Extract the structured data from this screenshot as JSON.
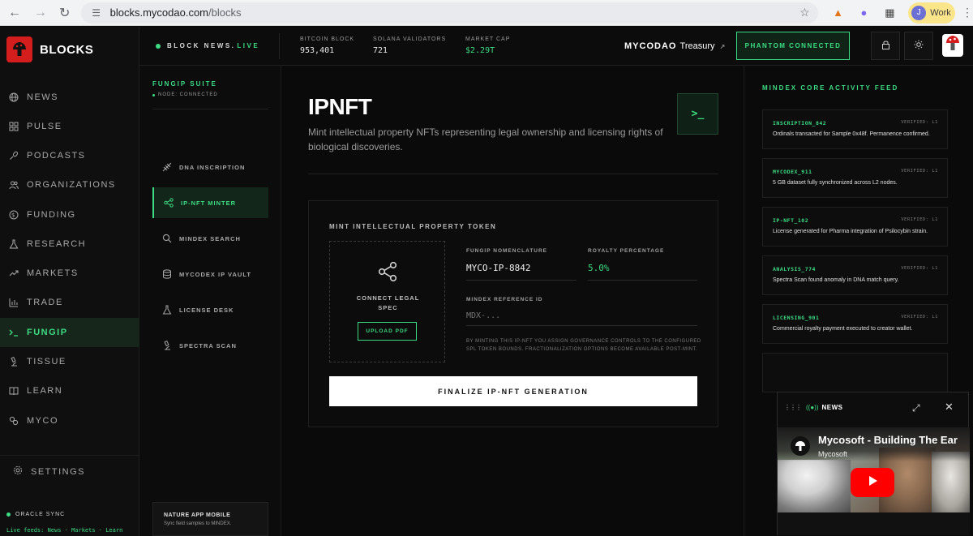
{
  "browser": {
    "url_host": "blocks.mycodao.com",
    "url_path": "/blocks",
    "profile_label": "Work",
    "profile_initial": "J"
  },
  "brand": {
    "name": "BLOCKS"
  },
  "nav": {
    "items": [
      {
        "label": "NEWS",
        "icon": "globe-icon"
      },
      {
        "label": "PULSE",
        "icon": "grid-icon"
      },
      {
        "label": "PODCASTS",
        "icon": "mic-icon"
      },
      {
        "label": "ORGANIZATIONS",
        "icon": "users-icon"
      },
      {
        "label": "FUNDING",
        "icon": "dollar-circle-icon"
      },
      {
        "label": "RESEARCH",
        "icon": "flask-icon"
      },
      {
        "label": "MARKETS",
        "icon": "trend-up-icon"
      },
      {
        "label": "TRADE",
        "icon": "bar-chart-icon"
      },
      {
        "label": "FUNGIP",
        "icon": "terminal-icon",
        "active": true
      },
      {
        "label": "TISSUE",
        "icon": "microscope-icon"
      },
      {
        "label": "LEARN",
        "icon": "book-icon"
      },
      {
        "label": "MYCO",
        "icon": "link-icon"
      }
    ],
    "settings_label": "SETTINGS",
    "oracle_label": "ORACLE SYNC",
    "live_feeds": "Live feeds: News · Markets · Learn"
  },
  "topbar": {
    "block_news": "BLOCK NEWS.",
    "live": "LIVE",
    "stats": [
      {
        "label": "BITCOIN BLOCK",
        "value": "953,401"
      },
      {
        "label": "SOLANA VALIDATORS",
        "value": "721"
      },
      {
        "label": "MARKET CAP",
        "value": "$2.29T"
      }
    ],
    "treasury_brand": "MYCODAO",
    "treasury_word": "Treasury",
    "phantom": "PHANTOM CONNECTED"
  },
  "suite": {
    "title": "FUNGIP SUITE",
    "node": "NODE: CONNECTED",
    "tools": [
      {
        "label": "DNA INSCRIPTION",
        "icon": "dna-icon"
      },
      {
        "label": "IP-NFT MINTER",
        "icon": "share-icon",
        "active": true
      },
      {
        "label": "MINDEX SEARCH",
        "icon": "search-icon"
      },
      {
        "label": "MYCODEX IP VAULT",
        "icon": "database-icon"
      },
      {
        "label": "LICENSE DESK",
        "icon": "flask-icon"
      },
      {
        "label": "SPECTRA SCAN",
        "icon": "microscope-icon"
      }
    ],
    "mobile_title": "NATURE APP MOBILE",
    "mobile_sub": "Sync field samples to MINDEX."
  },
  "main": {
    "title": "IPNFT",
    "description": "Mint intellectual property NFTs representing legal ownership and licensing rights of biological discoveries.",
    "terminal_glyph": ">_",
    "card_title": "MINT INTELLECTUAL PROPERTY TOKEN",
    "dropzone_text": "CONNECT LEGAL SPEC",
    "upload_label": "UPLOAD PDF",
    "nomenclature_label": "FUNGIP NOMENCLATURE",
    "nomenclature_value": "MYCO-IP-8842",
    "royalty_label": "ROYALTY PERCENTAGE",
    "royalty_value": "5.0%",
    "mindex_label": "MINDEX REFERENCE ID",
    "mindex_placeholder": "MDX-...",
    "disclaimer": "BY MINTING THIS IP-NFT YOU ASSIGN GOVERNANCE CONTROLS TO THE CONFIGURED SPL TOKEN BOUNDS. FRACTIONALIZATION OPTIONS BECOME AVAILABLE POST-MINT.",
    "finalize_label": "FINALIZE IP-NFT GENERATION"
  },
  "feed": {
    "title": "MINDEX CORE ACTIVITY FEED",
    "items": [
      {
        "code": "INSCRIPTION_842",
        "verified": "VERIFIED: L1",
        "message": "Ordinals transacted for Sample 0x48f. Permanence confirmed."
      },
      {
        "code": "MYCODEX_911",
        "verified": "VERIFIED: L1",
        "message": "5 GB dataset fully synchronized across L2 nodes."
      },
      {
        "code": "IP-NFT_102",
        "verified": "VERIFIED: L1",
        "message": "License generated for Pharma integration of Psilocybin strain."
      },
      {
        "code": "ANALYSIS_774",
        "verified": "VERIFIED: L1",
        "message": "Spectra Scan found anomaly in DNA match query."
      },
      {
        "code": "LICENSING_901",
        "verified": "VERIFIED: L1",
        "message": "Commercial royalty payment executed to creator wallet."
      }
    ]
  },
  "news_overlay": {
    "label": "NEWS",
    "video_title": "Mycosoft - Building The Ear",
    "video_channel": "Mycosoft"
  },
  "colors": {
    "accent": "#3ddc84",
    "background": "#0c0c0c",
    "logo": "#d41e1e"
  }
}
